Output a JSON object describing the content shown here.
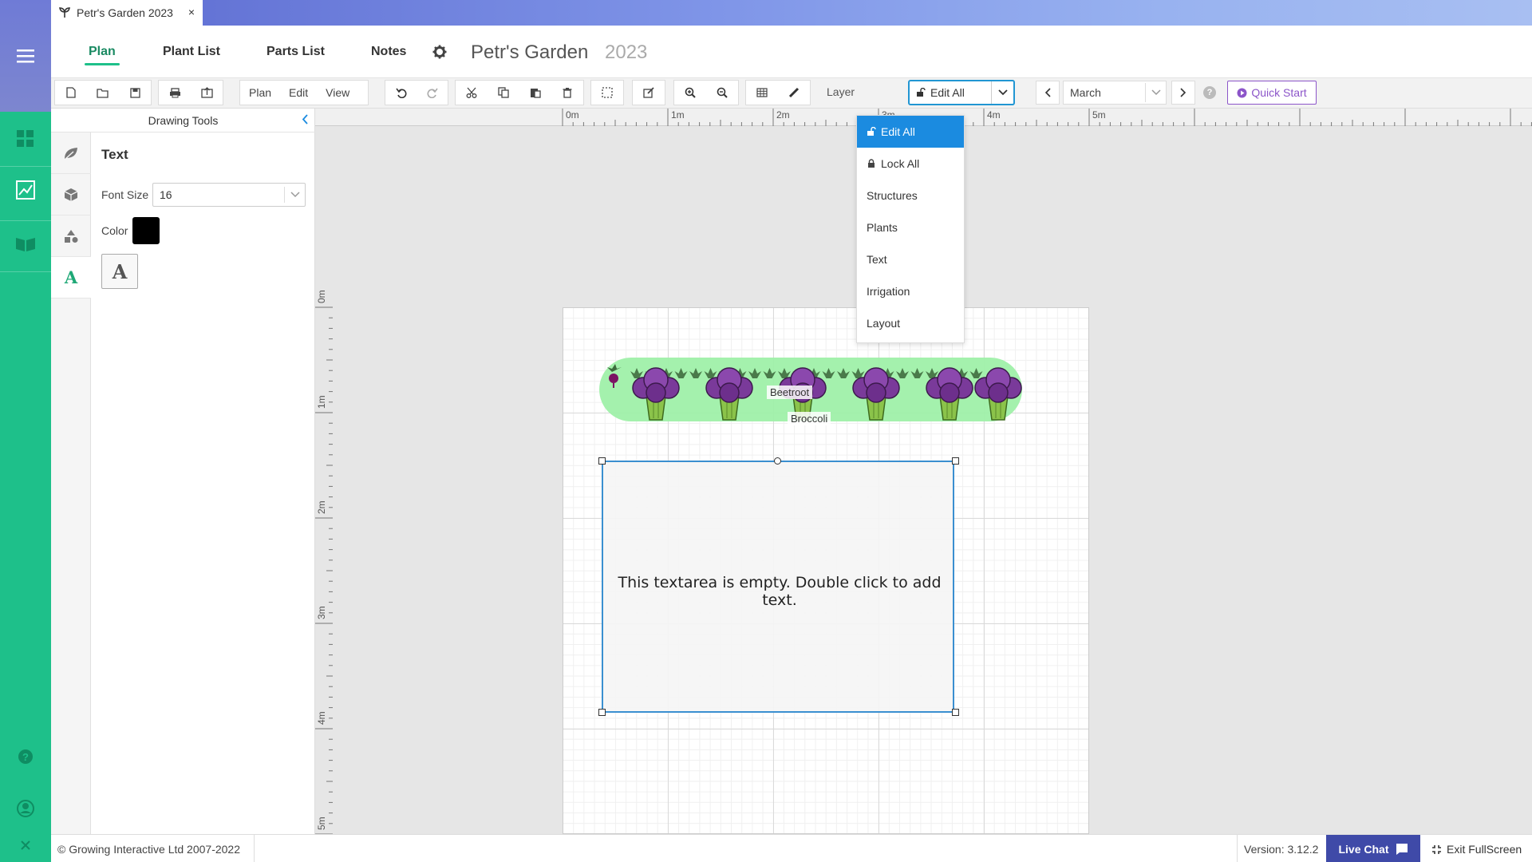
{
  "browser_tab": {
    "title": "Petr's Garden  2023",
    "close": "×"
  },
  "nav": {
    "tabs": [
      {
        "label": "Plan"
      },
      {
        "label": "Plant List"
      },
      {
        "label": "Parts List"
      },
      {
        "label": "Notes"
      }
    ],
    "title": "Petr's Garden",
    "year": "2023"
  },
  "toolbar": {
    "menus": [
      "Plan",
      "Edit",
      "View"
    ],
    "layer_label": "Layer",
    "layer_value": "Edit All",
    "month_value": "March",
    "quickstart_label": "Quick Start"
  },
  "layer_menu": {
    "items": [
      "Edit All",
      "Lock All",
      "Structures",
      "Plants",
      "Text",
      "Irrigation",
      "Layout"
    ],
    "selected": "Edit All"
  },
  "tools_panel": {
    "header": "Drawing Tools",
    "tool_title": "Text",
    "font_size_label": "Font Size",
    "font_size_value": "16",
    "color_label": "Color",
    "color_value": "#000000",
    "text_tool_glyph": "A"
  },
  "ruler": {
    "top": [
      "0m",
      "1m",
      "2m",
      "3m",
      "4m",
      "5m"
    ],
    "left": [
      "0m",
      "1m",
      "2m",
      "3m",
      "4m",
      "5m"
    ]
  },
  "canvas": {
    "plant_labels": [
      "Beetroot",
      "Broccoli"
    ],
    "textarea_placeholder": "This textarea is empty. Double click to add text."
  },
  "footer": {
    "copyright": "© Growing Interactive Ltd 2007-2022",
    "version": "Version: 3.12.2",
    "live_chat": "Live Chat",
    "exit_fullscreen": "Exit FullScreen"
  },
  "colors": {
    "rail_green": "#1ec08a",
    "accent_blue": "#1b8be0",
    "quickstart_purple": "#8c55c9",
    "livechat_blue": "#3f4aa8",
    "bed_green": "#9ff0a9",
    "broccoli_purple": "#7a3a9a"
  },
  "icons": [
    "hamburger-icon",
    "dashboard-icon",
    "chart-icon",
    "book-icon",
    "help-icon",
    "user-icon",
    "close-icon",
    "gear-icon"
  ]
}
